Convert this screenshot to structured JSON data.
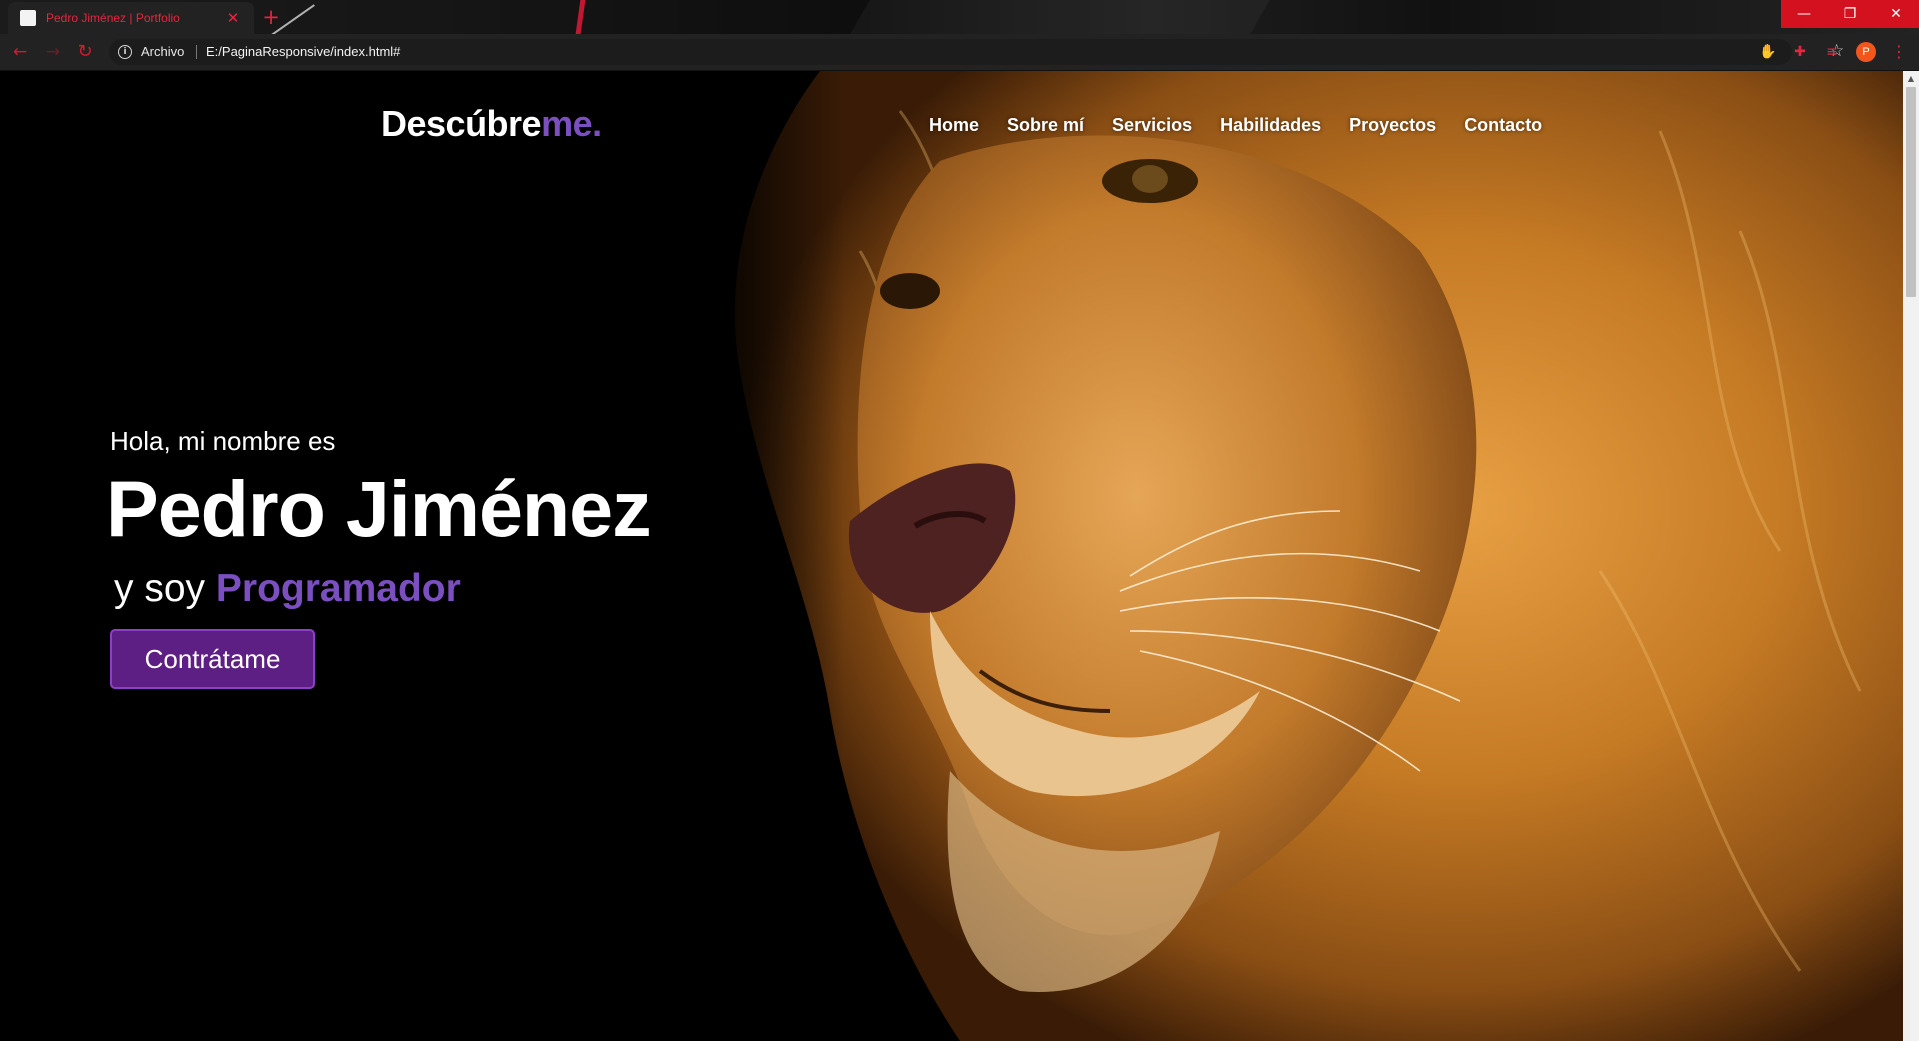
{
  "browser": {
    "tab": {
      "title": "Pedro Jiménez | Portfolio",
      "close_glyph": "✕"
    },
    "new_tab_glyph": "+",
    "window_controls": {
      "minimize": "—",
      "restore": "❐",
      "close": "✕"
    },
    "nav": {
      "back": "←",
      "forward": "→",
      "reload": "↻"
    },
    "address_bar": {
      "security_label": "Archivo",
      "info_glyph": "i",
      "url": "E:/PaginaResponsive/index.html#",
      "bookmark_glyph": "☆"
    },
    "extensions": [
      "✋",
      "✚",
      "≡"
    ],
    "profile_initial": "P",
    "menu_glyph": "⋮"
  },
  "page": {
    "logo": {
      "main": "Descúbre",
      "accent": "me."
    },
    "nav_links": [
      "Home",
      "Sobre mí",
      "Servicios",
      "Habilidades",
      "Proyectos",
      "Contacto"
    ],
    "hero": {
      "greeting": "Hola, mi nombre es",
      "name": "Pedro Jiménez",
      "role_prefix": "y soy",
      "role": "Programador",
      "cta": "Contrátame"
    }
  },
  "colors": {
    "accent": "#7b4fbf",
    "button_bg": "#5e1f84",
    "chrome_accent": "#e8243f"
  },
  "icons": [
    "info-icon",
    "star-icon",
    "back-icon",
    "forward-icon",
    "reload-icon",
    "close-icon",
    "menu-icon",
    "lion-image"
  ]
}
